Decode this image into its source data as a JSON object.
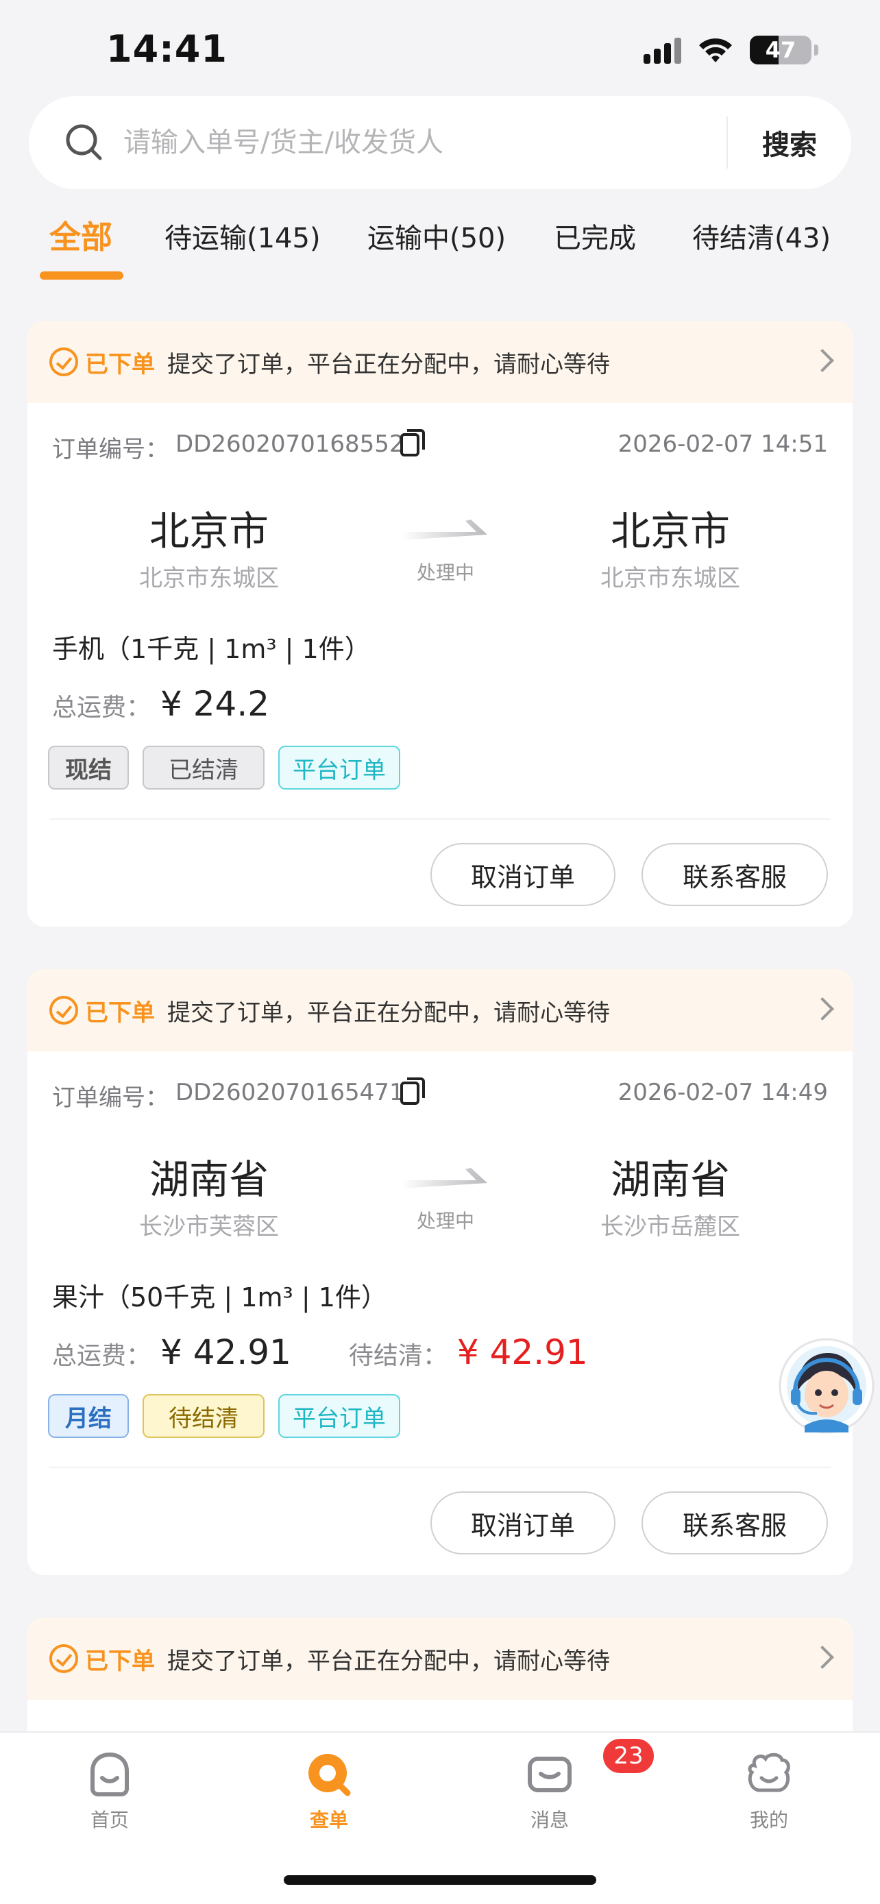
{
  "status_bar": {
    "time": "14:41",
    "battery": "47"
  },
  "search": {
    "placeholder": "请输入单号/货主/收发货人",
    "button_label": "搜索"
  },
  "tabs": [
    {
      "label": "全部",
      "active": true
    },
    {
      "label": "待运输(145)"
    },
    {
      "label": "运输中(50)"
    },
    {
      "label": "已完成"
    },
    {
      "label": "待结清(43)"
    }
  ],
  "orders": [
    {
      "banner_status": "已下单",
      "banner_text": "提交了订单，平台正在分配中，请耐心等待",
      "order_label": "订单编号：",
      "order_id": "DD2602070168552",
      "order_time": "2026-02-07 14:51",
      "from_city": "北京市",
      "from_district": "北京市东城区",
      "route_status": "处理中",
      "to_city": "北京市",
      "to_district": "北京市东城区",
      "goods": "手机（1千克 | 1m³ | 1件）",
      "fee_label": "总运费：",
      "fee_value": "¥ 24.2",
      "tags": [
        "现结",
        "已结清",
        "平台订单"
      ],
      "cancel_label": "取消订单",
      "contact_label": "联系客服"
    },
    {
      "banner_status": "已下单",
      "banner_text": "提交了订单，平台正在分配中，请耐心等待",
      "order_label": "订单编号：",
      "order_id": "DD2602070165471",
      "order_time": "2026-02-07 14:49",
      "from_city": "湖南省",
      "from_district": "长沙市芙蓉区",
      "route_status": "处理中",
      "to_city": "湖南省",
      "to_district": "长沙市岳麓区",
      "goods": "果汁（50千克 | 1m³ | 1件）",
      "fee_label": "总运费：",
      "fee_value": "¥ 42.91",
      "pending_label": "待结清：",
      "pending_value": "¥ 42.91",
      "tags": [
        "月结",
        "待结清",
        "平台订单"
      ],
      "cancel_label": "取消订单",
      "contact_label": "联系客服"
    },
    {
      "banner_status": "已下单",
      "banner_text": "提交了订单，平台正在分配中，请耐心等待"
    }
  ],
  "bottom_nav": [
    {
      "label": "首页",
      "icon": "home-face-icon"
    },
    {
      "label": "查单",
      "icon": "search-order-icon",
      "active": true
    },
    {
      "label": "消息",
      "icon": "message-icon",
      "badge": "23"
    },
    {
      "label": "我的",
      "icon": "profile-face-icon"
    }
  ],
  "colors": {
    "accent": "#f7931e",
    "price_red": "#e51f1f",
    "background": "#f4f4f6"
  }
}
